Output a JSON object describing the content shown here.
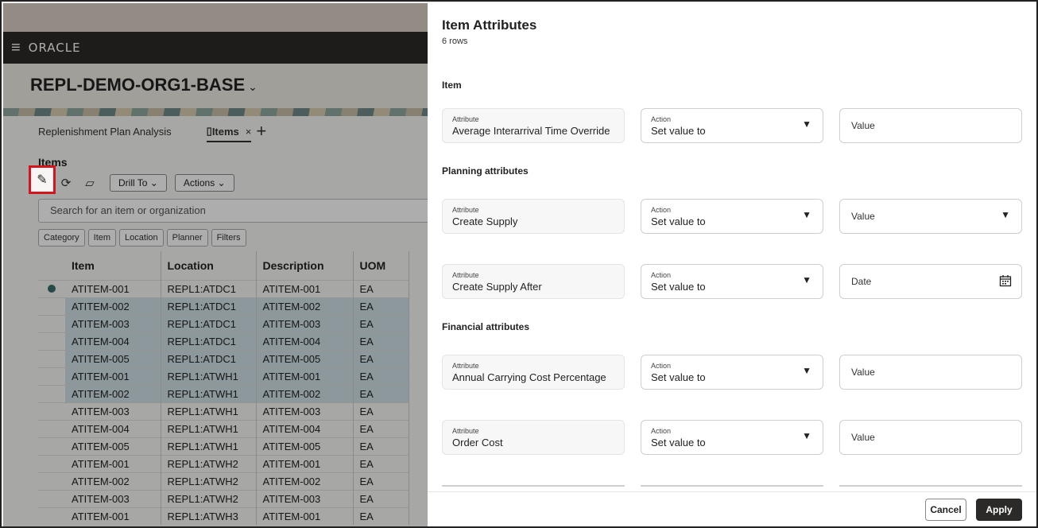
{
  "app": {
    "brand": "ORACLE",
    "org_title": "REPL-DEMO-ORG1-BASE",
    "tabs": [
      "Replenishment Plan Analysis",
      "Items"
    ],
    "section_title": "Items",
    "toolbar": {
      "drill_to": "Drill To",
      "actions": "Actions"
    },
    "search_placeholder": "Search for an item or organization",
    "chips": [
      "Category",
      "Item",
      "Location",
      "Planner",
      "Filters"
    ],
    "columns": [
      "Item",
      "Location",
      "Description",
      "UOM"
    ],
    "rows": [
      {
        "item": "ATITEM-001",
        "location": "REPL1:ATDC1",
        "description": "ATITEM-001",
        "uom": "EA",
        "selected": false,
        "current": true
      },
      {
        "item": "ATITEM-002",
        "location": "REPL1:ATDC1",
        "description": "ATITEM-002",
        "uom": "EA",
        "selected": true
      },
      {
        "item": "ATITEM-003",
        "location": "REPL1:ATDC1",
        "description": "ATITEM-003",
        "uom": "EA",
        "selected": true
      },
      {
        "item": "ATITEM-004",
        "location": "REPL1:ATDC1",
        "description": "ATITEM-004",
        "uom": "EA",
        "selected": true
      },
      {
        "item": "ATITEM-005",
        "location": "REPL1:ATDC1",
        "description": "ATITEM-005",
        "uom": "EA",
        "selected": true
      },
      {
        "item": "ATITEM-001",
        "location": "REPL1:ATWH1",
        "description": "ATITEM-001",
        "uom": "EA",
        "selected": true
      },
      {
        "item": "ATITEM-002",
        "location": "REPL1:ATWH1",
        "description": "ATITEM-002",
        "uom": "EA",
        "selected": true
      },
      {
        "item": "ATITEM-003",
        "location": "REPL1:ATWH1",
        "description": "ATITEM-003",
        "uom": "EA",
        "selected": false
      },
      {
        "item": "ATITEM-004",
        "location": "REPL1:ATWH1",
        "description": "ATITEM-004",
        "uom": "EA",
        "selected": false
      },
      {
        "item": "ATITEM-005",
        "location": "REPL1:ATWH1",
        "description": "ATITEM-005",
        "uom": "EA",
        "selected": false
      },
      {
        "item": "ATITEM-001",
        "location": "REPL1:ATWH2",
        "description": "ATITEM-001",
        "uom": "EA",
        "selected": false
      },
      {
        "item": "ATITEM-002",
        "location": "REPL1:ATWH2",
        "description": "ATITEM-002",
        "uom": "EA",
        "selected": false
      },
      {
        "item": "ATITEM-003",
        "location": "REPL1:ATWH2",
        "description": "ATITEM-003",
        "uom": "EA",
        "selected": false
      },
      {
        "item": "ATITEM-001",
        "location": "REPL1:ATWH3",
        "description": "ATITEM-001",
        "uom": "EA",
        "selected": false
      }
    ]
  },
  "drawer": {
    "title": "Item Attributes",
    "subtitle": "6 rows",
    "labels": {
      "attribute": "Attribute",
      "action": "Action"
    },
    "groups": {
      "item": "Item",
      "planning": "Planning attributes",
      "financial": "Financial attributes"
    },
    "fields": [
      {
        "attribute": "Average Interarrival Time Override",
        "action": "Set value to",
        "value_placeholder": "Value",
        "value_type": "text"
      },
      {
        "attribute": "Create Supply",
        "action": "Set value to",
        "value_placeholder": "Value",
        "value_type": "select"
      },
      {
        "attribute": "Create Supply After",
        "action": "Set value to",
        "value_placeholder": "Date",
        "value_type": "date"
      },
      {
        "attribute": "Annual Carrying Cost Percentage",
        "action": "Set value to",
        "value_placeholder": "Value",
        "value_type": "text"
      },
      {
        "attribute": "Order Cost",
        "action": "Set value to",
        "value_placeholder": "Value",
        "value_type": "text"
      }
    ],
    "buttons": {
      "cancel": "Cancel",
      "apply": "Apply"
    }
  },
  "colors": {
    "highlight_red": "#d6141d",
    "selected_row": "#cfe0e6",
    "dark_bar": "#2b2a28"
  }
}
